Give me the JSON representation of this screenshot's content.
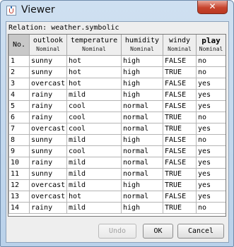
{
  "window": {
    "title": "Viewer",
    "close_label": "✕"
  },
  "relation_label": "Relation: weather.symbolic",
  "table": {
    "columns": [
      {
        "name": "No.",
        "type": ""
      },
      {
        "name": "outlook",
        "type": "Nominal"
      },
      {
        "name": "temperature",
        "type": "Nominal"
      },
      {
        "name": "humidity",
        "type": "Nominal"
      },
      {
        "name": "windy",
        "type": "Nominal"
      },
      {
        "name": "play",
        "type": "Nominal"
      }
    ],
    "rows": [
      [
        "1",
        "sunny",
        "hot",
        "high",
        "FALSE",
        "no"
      ],
      [
        "2",
        "sunny",
        "hot",
        "high",
        "TRUE",
        "no"
      ],
      [
        "3",
        "overcast",
        "hot",
        "high",
        "FALSE",
        "yes"
      ],
      [
        "4",
        "rainy",
        "mild",
        "high",
        "FALSE",
        "yes"
      ],
      [
        "5",
        "rainy",
        "cool",
        "normal",
        "FALSE",
        "yes"
      ],
      [
        "6",
        "rainy",
        "cool",
        "normal",
        "TRUE",
        "no"
      ],
      [
        "7",
        "overcast",
        "cool",
        "normal",
        "TRUE",
        "yes"
      ],
      [
        "8",
        "sunny",
        "mild",
        "high",
        "FALSE",
        "no"
      ],
      [
        "9",
        "sunny",
        "cool",
        "normal",
        "FALSE",
        "yes"
      ],
      [
        "10",
        "rainy",
        "mild",
        "normal",
        "FALSE",
        "yes"
      ],
      [
        "11",
        "sunny",
        "mild",
        "normal",
        "TRUE",
        "yes"
      ],
      [
        "12",
        "overcast",
        "mild",
        "high",
        "TRUE",
        "yes"
      ],
      [
        "13",
        "overcast",
        "hot",
        "normal",
        "FALSE",
        "yes"
      ],
      [
        "14",
        "rainy",
        "mild",
        "high",
        "TRUE",
        "no"
      ]
    ]
  },
  "buttons": {
    "undo": "Undo",
    "ok": "OK",
    "cancel": "Cancel"
  },
  "colors": {
    "title_bar": "#c3d8ee",
    "close_button": "#c7442d",
    "header_selected": "#c8c8c8"
  },
  "icons": {
    "app": "weka-icon",
    "close": "close-icon"
  }
}
